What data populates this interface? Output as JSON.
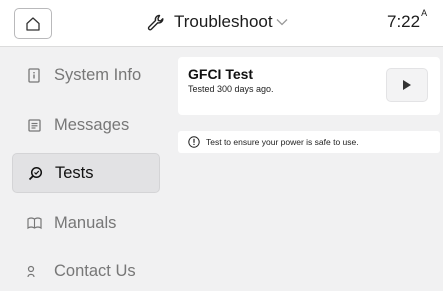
{
  "header": {
    "title": "Troubleshoot",
    "time": "7:22",
    "time_suffix": "A"
  },
  "sidebar": {
    "items": [
      {
        "label": "System Info",
        "icon": "device-info-icon",
        "active": false
      },
      {
        "label": "Messages",
        "icon": "message-icon",
        "active": false
      },
      {
        "label": "Tests",
        "icon": "search-test-icon",
        "active": true
      },
      {
        "label": "Manuals",
        "icon": "manual-icon",
        "active": false
      },
      {
        "label": "Contact Us",
        "icon": "contact-icon",
        "active": false
      }
    ]
  },
  "main": {
    "test_card": {
      "title": "GFCI Test",
      "subtitle": "Tested 300 days ago."
    },
    "info": {
      "text": "Test to ensure your power is safe to use."
    }
  },
  "colors": {
    "background": "#f1f1f2",
    "card": "#ffffff",
    "active_nav": "#e2e2e4",
    "muted_text": "#777777"
  }
}
